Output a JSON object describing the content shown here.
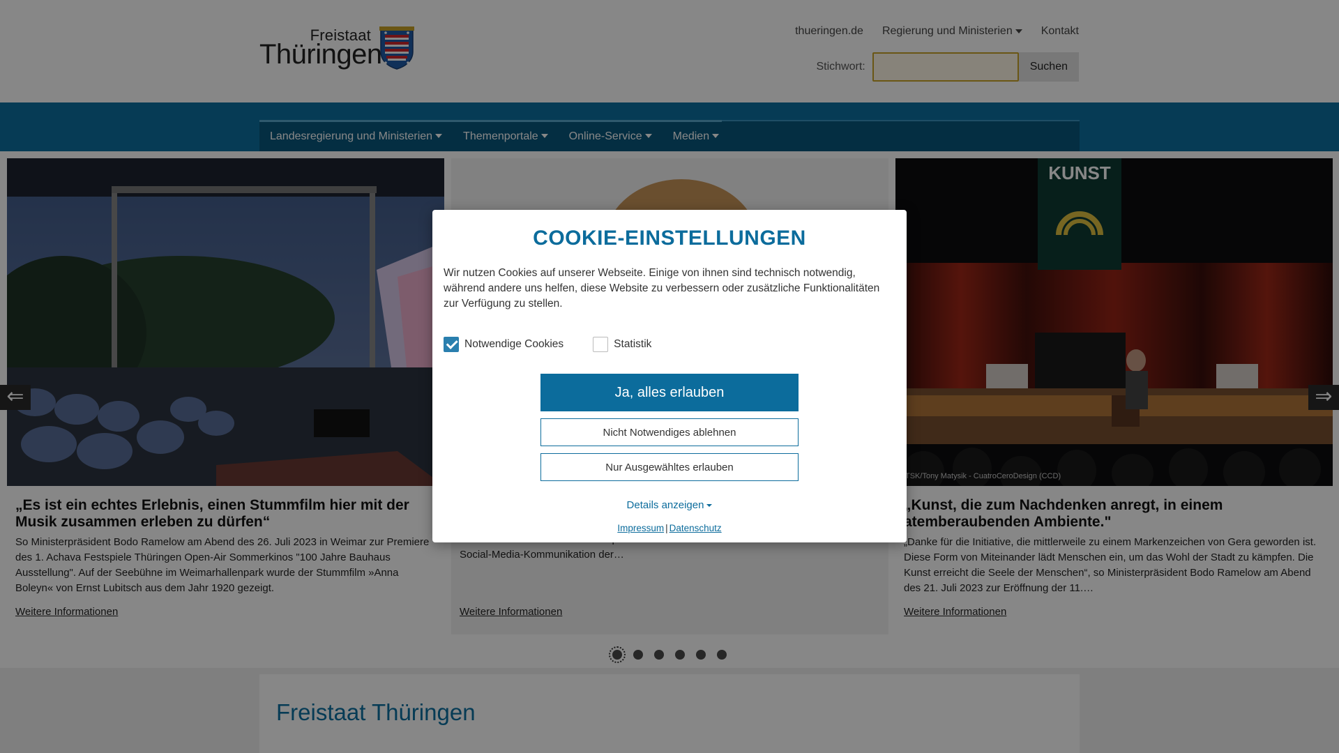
{
  "header": {
    "logo_small": "Freistaat",
    "logo_big": "Thüringen",
    "top_links": [
      "thueringen.de",
      "Regierung und Ministerien",
      "Kontakt"
    ],
    "search_label": "Stichwort:",
    "search_value": "",
    "search_button": "Suchen"
  },
  "main_nav": [
    "Landesregierung und Ministerien",
    "Themenportale",
    "Online-Service",
    "Medien"
  ],
  "carousel": {
    "cards": [
      {
        "title": "„Es ist ein echtes Erlebnis, einen Stummfilm hier mit der Musik zusammen erleben zu dürfen“",
        "desc": "So Ministerpräsident Bodo Ramelow am Abend des 26. Juli 2023 in Weimar zur Premiere des 1. Achava Festspiele Thüringen Open-Air Sommerkinos \"100 Jahre Bauhaus Ausstellung\". Auf der Seebühne im Weimarhallenpark wurde der Stummfilm »Anna Boleyn« von Ernst Lubitsch aus dem Jahr 1920 gezeigt.",
        "more": "Weitere Informationen",
        "credit": ""
      },
      {
        "title": "",
        "desc": "Das Thüringer Kabinett hat … zur stellvertretenden Sprecherin der Thüringer Landesregierung berufen. Die in Bernburg geborene Diplom-Journalistin war zuvor mehrere Jahre stellvertretende Sprecherin des Berliner Senats und verantwortete die Social-Media-Kommunikation der…",
        "more": "Weitere Informationen",
        "credit": ""
      },
      {
        "title": "„Kunst, die zum Nachdenken anregt, in einem atemberaubenden Ambiente.\"",
        "desc": "„Danke für die Initiative, die mittlerweile zu einem Markenzeichen von Gera geworden ist. Diese Form von Miteinander lädt Menschen ein, um das Wohl der Stadt zu kämpfen. Die Kunst erreicht die Seele der Menschen“, so Ministerpräsident Bodo Ramelow am Abend des 21. Juli 2023 zur Eröffnung der 11.…",
        "more": "Weitere Informationen",
        "credit": "TSK/Tony Matysik - CuatroCeroDesign (CCD)"
      }
    ],
    "arrow_left": "⇐",
    "arrow_right": "⇒",
    "dots_count": 6,
    "active_dot": 1,
    "poster_title": "KUNST"
  },
  "intro": {
    "heading": "Freistaat Thüringen"
  },
  "cookie": {
    "title": "COOKIE-EINSTELLUNGEN",
    "text": "Wir nutzen Cookies auf unserer Webseite. Einige von ihnen sind technisch notwendig, während andere uns helfen, diese Website zu verbessern oder zusätzliche Funktionalitäten zur Verfügung zu stellen.",
    "options": [
      {
        "label": "Notwendige Cookies",
        "checked": true
      },
      {
        "label": "Statistik",
        "checked": false
      }
    ],
    "accept_all": "Ja, alles erlauben",
    "decline": "Nicht Notwendiges ablehnen",
    "accept_selected": "Nur Ausgewähltes erlauben",
    "details": "Details anzeigen",
    "impressum": "Impressum",
    "separator": "|",
    "datenschutz": "Datenschutz"
  },
  "colors": {
    "brand_blue": "#0c6c9c",
    "nav_band": "#0c70a0",
    "nav_dark": "#09577d"
  }
}
